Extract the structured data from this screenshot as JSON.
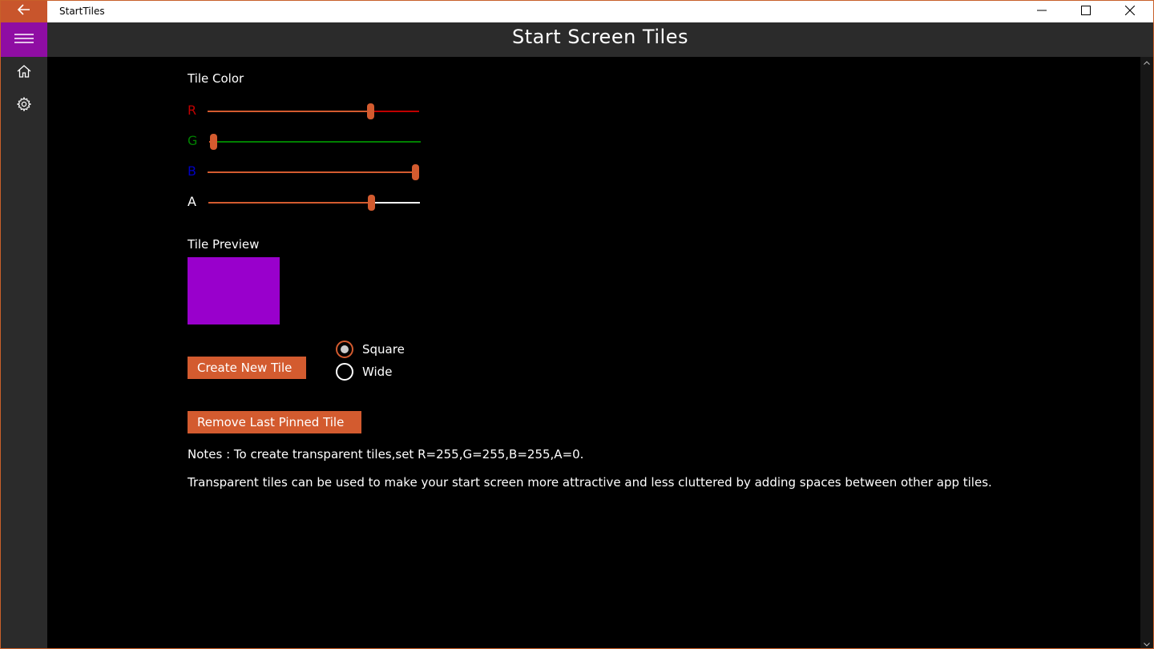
{
  "window": {
    "app_name": "StartTiles",
    "controls": {
      "minimize": "minimize-icon",
      "maximize": "maximize-icon",
      "close": "close-icon"
    },
    "back_icon": "back-arrow-icon"
  },
  "header": {
    "menu_icon": "hamburger-icon",
    "title": "Start Screen Tiles"
  },
  "nav": {
    "items": [
      {
        "icon": "home-icon"
      },
      {
        "icon": "gear-icon"
      }
    ]
  },
  "tile_color": {
    "label": "Tile Color",
    "channels": [
      {
        "letter": "R",
        "color": "#c00000",
        "value_fraction": 0.77,
        "rest_color": "#c00000"
      },
      {
        "letter": "G",
        "color": "#008000",
        "value_fraction": 0.02,
        "rest_color": "#008000"
      },
      {
        "letter": "B",
        "color": "#0000c0",
        "value_fraction": 1.0,
        "rest_color": "#0000c0"
      },
      {
        "letter": "A",
        "color": "#ffffff",
        "value_fraction": 0.77,
        "rest_color": "#ffffff"
      }
    ]
  },
  "tile_preview": {
    "label": "Tile Preview",
    "color": "#9900cc"
  },
  "actions": {
    "create_label": "Create New Tile",
    "remove_label": "Remove Last Pinned Tile"
  },
  "tile_size": {
    "options": [
      {
        "label": "Square",
        "checked": true
      },
      {
        "label": "Wide",
        "checked": false
      }
    ]
  },
  "notes": {
    "line1": "Notes : To create transparent tiles,set R=255,G=255,B=255,A=0.",
    "line2": "Transparent tiles can be used to make your start screen more attractive and less cluttered by adding spaces between other app tiles."
  },
  "colors": {
    "accent": "#d35b2f",
    "menu_bg": "#8f0da3",
    "chrome_bg": "#2b2b2b"
  }
}
